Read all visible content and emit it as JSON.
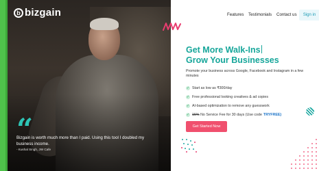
{
  "brand": {
    "name": "bizgain",
    "icon": "b-logo-icon"
  },
  "nav": {
    "features": "Features",
    "testimonials": "Testimonials",
    "contact": "Contact us",
    "signin": "Sign in"
  },
  "hero": {
    "heading_line1": "Get More Walk-Ins",
    "heading_line2": "Grow Your Businesses",
    "subheading": "Promote your business across Google, Facebook and Instagram in a few minutes",
    "features": [
      {
        "text": "Start as low as ₹300/day"
      },
      {
        "text": "Free professional looking creatives & ad copies"
      },
      {
        "text": "AI-based optimization to remove any guesswork"
      },
      {
        "strike": "15%",
        "text": "No Service Fee for 30 days (Use code",
        "code": "TRYFREE)"
      }
    ],
    "cta": "Get Started Now"
  },
  "testimonial": {
    "quote": "Bizgain is worth much more than I paid. Using this tool I doubled my business income.",
    "author": "- Kushal Singh, JW Cafe"
  },
  "colors": {
    "accent": "#16a69a",
    "cta": "#f0506e",
    "green_edge": "#4fc24b",
    "quote": "#2ec4b6"
  }
}
